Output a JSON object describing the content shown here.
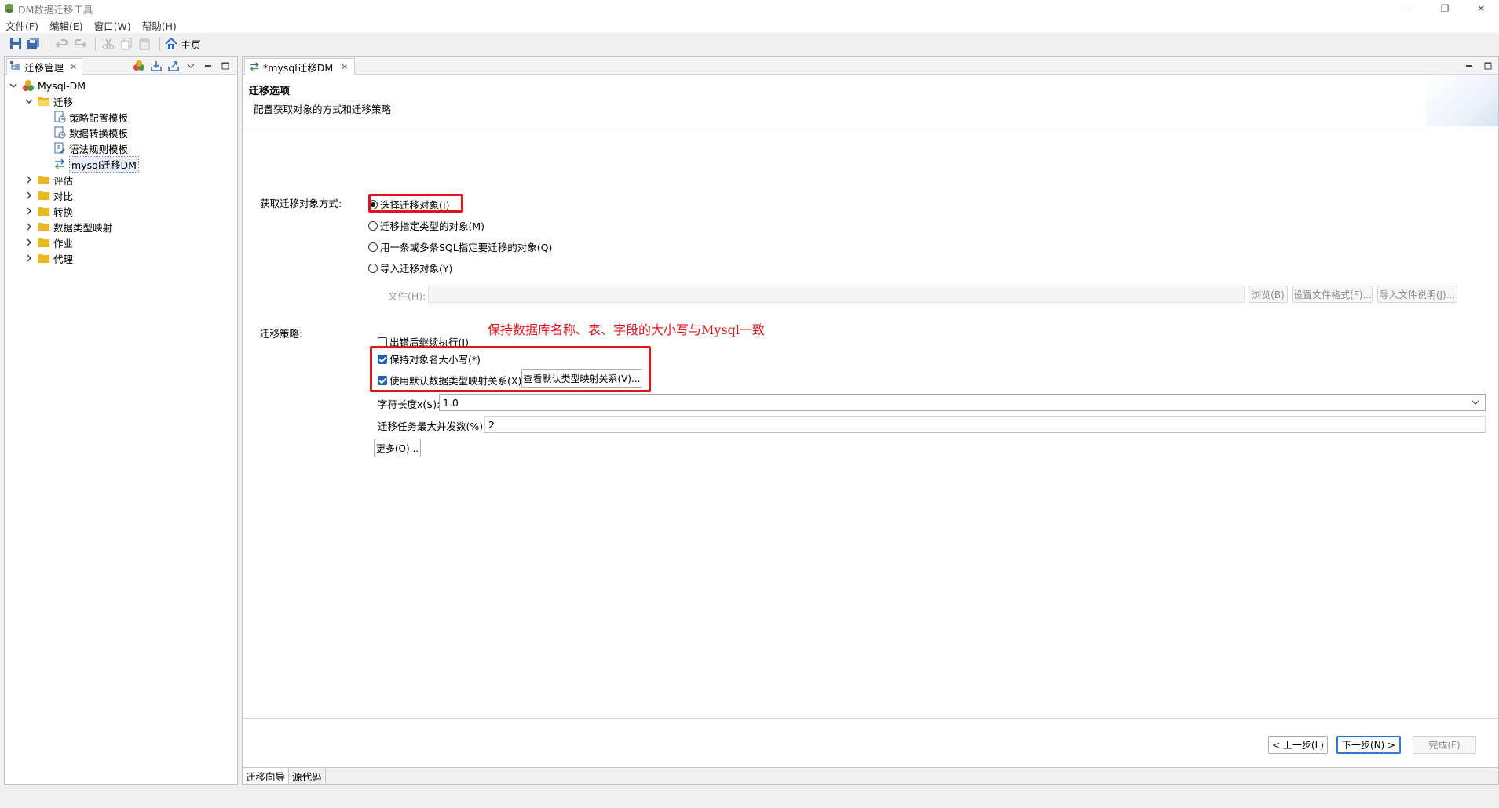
{
  "window": {
    "title": "DM数据迁移工具",
    "controls": [
      "minimize",
      "restore",
      "close"
    ]
  },
  "menubar": {
    "items": [
      "文件(F)",
      "编辑(E)",
      "窗口(W)",
      "帮助(H)"
    ]
  },
  "toolbar": {
    "home_label": "主页"
  },
  "left_panel": {
    "tab_label": "迁移管理",
    "tree": {
      "root": "Mysql-DM",
      "migration_folder": "迁移",
      "migration_children": [
        "策略配置模板",
        "数据转换模板",
        "语法规则模板",
        "mysql迁移DM"
      ],
      "folders": [
        "评估",
        "对比",
        "转换",
        "数据类型映射",
        "作业",
        "代理"
      ]
    }
  },
  "editor": {
    "tab_label": "*mysql迁移DM",
    "header_title": "迁移选项",
    "header_desc": "配置获取对象的方式和迁移策略",
    "acquire_label": "获取迁移对象方式:",
    "radio_options": [
      {
        "label": "选择迁移对象(I)",
        "checked": true
      },
      {
        "label": "迁移指定类型的对象(M)",
        "checked": false
      },
      {
        "label": "用一条或多条SQL指定要迁移的对象(Q)",
        "checked": false
      },
      {
        "label": "导入迁移对象(Y)",
        "checked": false
      }
    ],
    "file_label": "文件(H):",
    "browse_button": "浏览(B)",
    "file_format_button": "设置文件格式(F)...",
    "import_desc_button": "导入文件说明(J)...",
    "strategy_label": "迁移策略:",
    "annotation": "保持数据库名称、表、字段的大小写与Mysql一致",
    "checkboxes": [
      {
        "label": "出错后继续执行(I)",
        "checked": false
      },
      {
        "label": "保持对象名大小写(*)",
        "checked": true
      },
      {
        "label": "使用默认数据类型映射关系(X)",
        "checked": true
      }
    ],
    "view_mapping_button": "查看默认类型映射关系(V)...",
    "char_length_label": "字符长度x($):",
    "char_length_value": "1.0",
    "max_concurrency_label": "迁移任务最大并发数(%):",
    "max_concurrency_value": "2",
    "more_button": "更多(O)...",
    "prev_button": "< 上一步(L)",
    "next_button": "下一步(N) >",
    "finish_button": "完成(F)",
    "bottom_tabs": [
      "迁移向导",
      "源代码"
    ]
  },
  "colors": {
    "annotation_red": "#e3131b",
    "check_blue": "#1f5fb4",
    "folder_yellow": "#e8b923"
  }
}
